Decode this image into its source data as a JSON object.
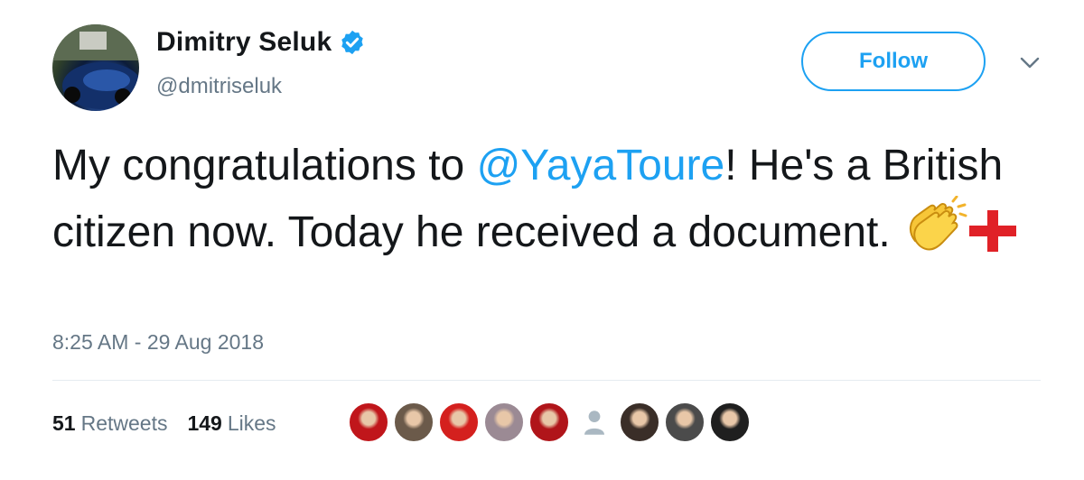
{
  "author": {
    "display_name": "Dimitry Seluk",
    "handle": "@dmitriseluk",
    "verified": true,
    "avatar": "profile-photo"
  },
  "actions": {
    "follow_label": "Follow",
    "more_icon": "chevron-down-icon"
  },
  "tweet": {
    "text_before": "My congratulations to ",
    "mention": "@YayaToure",
    "text_after": "! He's a British citizen now. Today he received a document. ",
    "emojis": [
      "clapping-hands-icon",
      "england-cross-icon"
    ],
    "timestamp": "8:25 AM - 29 Aug 2018"
  },
  "stats": {
    "retweets_count": "51",
    "retweets_label": "Retweets",
    "likes_count": "149",
    "likes_label": "Likes"
  },
  "likers": [
    {
      "name": "liker-avatar",
      "color": "#c0161b"
    },
    {
      "name": "liker-avatar",
      "color": "#6b5a4a"
    },
    {
      "name": "liker-avatar",
      "color": "#d4201e"
    },
    {
      "name": "liker-avatar",
      "color": "#9b8a94"
    },
    {
      "name": "liker-avatar",
      "color": "#b0151a"
    },
    {
      "name": "liker-avatar-default",
      "color": "#aab8c2"
    },
    {
      "name": "liker-avatar",
      "color": "#3a2e28"
    },
    {
      "name": "liker-avatar",
      "color": "#4b4b4b"
    },
    {
      "name": "liker-avatar",
      "color": "#1f1f1f"
    }
  ],
  "colors": {
    "accent": "#1da1f2",
    "text": "#14171a",
    "secondary": "#657786"
  }
}
